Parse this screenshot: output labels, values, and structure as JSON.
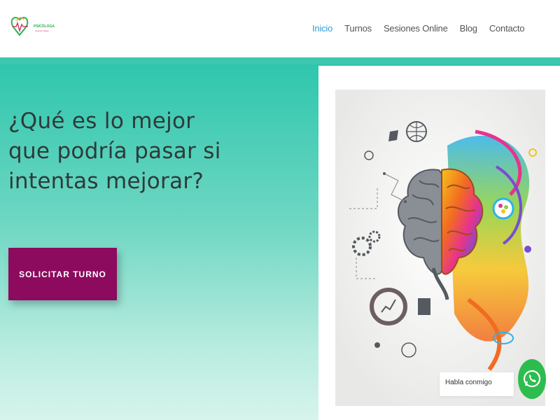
{
  "header": {
    "logo_text": "PSICÓLOGA",
    "logo_sub": "Susana Vallejo",
    "nav": [
      {
        "label": "Inicio",
        "active": true
      },
      {
        "label": "Turnos",
        "active": false
      },
      {
        "label": "Sesiones Online",
        "active": false
      },
      {
        "label": "Blog",
        "active": false
      },
      {
        "label": "Contacto",
        "active": false
      }
    ]
  },
  "hero": {
    "title": "¿Qué es lo mejor que podría pasar si intentas mejorar?",
    "cta_label": "SOLICITAR TURNO"
  },
  "chat": {
    "label": "Habla conmigo"
  },
  "colors": {
    "accent": "#2d9fd6",
    "teal": "#3cc7ae",
    "cta": "#8c0b5e",
    "whatsapp": "#2dbc4e"
  },
  "icons": [
    "logo-heart-icon",
    "brain-illustration",
    "whatsapp-icon"
  ]
}
